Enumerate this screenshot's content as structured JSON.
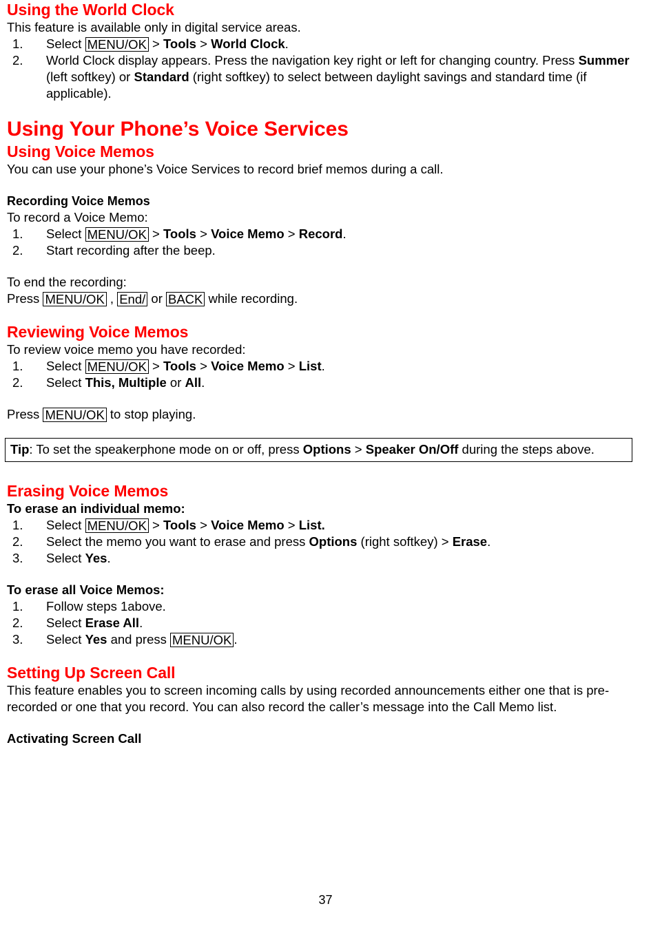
{
  "page": {
    "number": "37"
  },
  "sections": {
    "world_clock": {
      "heading": "Using the World Clock",
      "intro": "This feature is available only in digital service areas.",
      "steps": [
        {
          "num": "1.",
          "pre": "Select ",
          "key": "MENU/OK",
          "mid": " > ",
          "b1": "Tools",
          "sep": " > ",
          "b2": "World Clock",
          "post": "."
        },
        {
          "num": "2.",
          "text_1": "World Clock display appears. Press the navigation key right or left for changing country. Press ",
          "b1": "Summer",
          "text_2": " (left softkey) or ",
          "b2": "Standard",
          "text_3": " (right softkey) to select between daylight savings and standard time (if applicable)."
        }
      ]
    },
    "voice_services": {
      "heading": "Using Your Phone’s Voice Services",
      "subheading": "Using Voice Memos",
      "intro": "You can use your phone’s Voice Services to record brief memos during a call."
    },
    "recording": {
      "heading": "Recording Voice Memos",
      "intro": "To record a Voice Memo:",
      "steps": [
        {
          "num": "1.",
          "pre": "Select ",
          "key": "MENU/OK",
          "mid": " > ",
          "b1": "Tools",
          "sep1": " > ",
          "b2": "Voice Memo",
          "sep2": " > ",
          "b3": "Record",
          "post": "."
        },
        {
          "num": "2.",
          "text": "Start recording after the beep."
        }
      ],
      "end_intro": "To end the recording:",
      "end_line": {
        "pre": "Press ",
        "key1": "MENU/OK",
        "mid1": " , ",
        "key2": "End/",
        "mid2": " or ",
        "key3": "BACK",
        "post": " while recording."
      }
    },
    "reviewing": {
      "heading": "Reviewing Voice Memos",
      "intro": "To review voice memo you have recorded:",
      "steps": [
        {
          "num": "1.",
          "pre": "Select ",
          "key": "MENU/OK",
          "mid": " > ",
          "b1": "Tools",
          "sep1": " > ",
          "b2": "Voice Memo",
          "sep2": " > ",
          "b3": "List",
          "post": "."
        },
        {
          "num": "2.",
          "pre": "Select ",
          "b1": "This, Multiple",
          "mid": " or ",
          "b2": "All",
          "post": "."
        }
      ],
      "stop_line": {
        "pre": "Press ",
        "key": "MENU/OK",
        "post": " to stop playing."
      }
    },
    "tip": {
      "label": "Tip",
      "text_1": ": To set the speakerphone mode on or off, press ",
      "b1": "Options",
      "text_2": " > ",
      "b2": "Speaker On/Off",
      "text_3": " during the steps above."
    },
    "erasing": {
      "heading": "Erasing Voice Memos",
      "individual_heading": "To erase an individual memo:",
      "individual_steps": [
        {
          "num": "1.",
          "pre": "Select ",
          "key": "MENU/OK",
          "mid": " > ",
          "b1": "Tools",
          "sep1": " > ",
          "b2": "Voice Memo",
          "sep2": " > ",
          "b3": "List."
        },
        {
          "num": "2.",
          "text_1": "Select the memo you want to erase and press ",
          "b1": "Options",
          "text_2": " (right softkey) > ",
          "b2": "Erase",
          "text_3": "."
        },
        {
          "num": "3.",
          "pre": "Select ",
          "b1": "Yes",
          "post": "."
        }
      ],
      "all_heading": "To erase all Voice Memos:",
      "all_steps": [
        {
          "num": "1.",
          "text": "Follow steps 1above."
        },
        {
          "num": "2.",
          "pre": "Select ",
          "b1": "Erase All",
          "post": "."
        },
        {
          "num": "3.",
          "pre": "Select ",
          "b1": "Yes",
          "mid": " and press ",
          "key": "MENU/OK",
          "post": "."
        }
      ]
    },
    "screen_call": {
      "heading": "Setting Up Screen Call",
      "intro": "This feature enables you to screen incoming calls by using recorded announcements either one that is pre-recorded or one that you record. You can also record the caller’s message into the Call Memo list.",
      "activating_heading": "Activating Screen Call"
    }
  },
  "colors": {
    "heading_red": "#ff0000",
    "text_black": "#000000",
    "background": "#ffffff"
  }
}
